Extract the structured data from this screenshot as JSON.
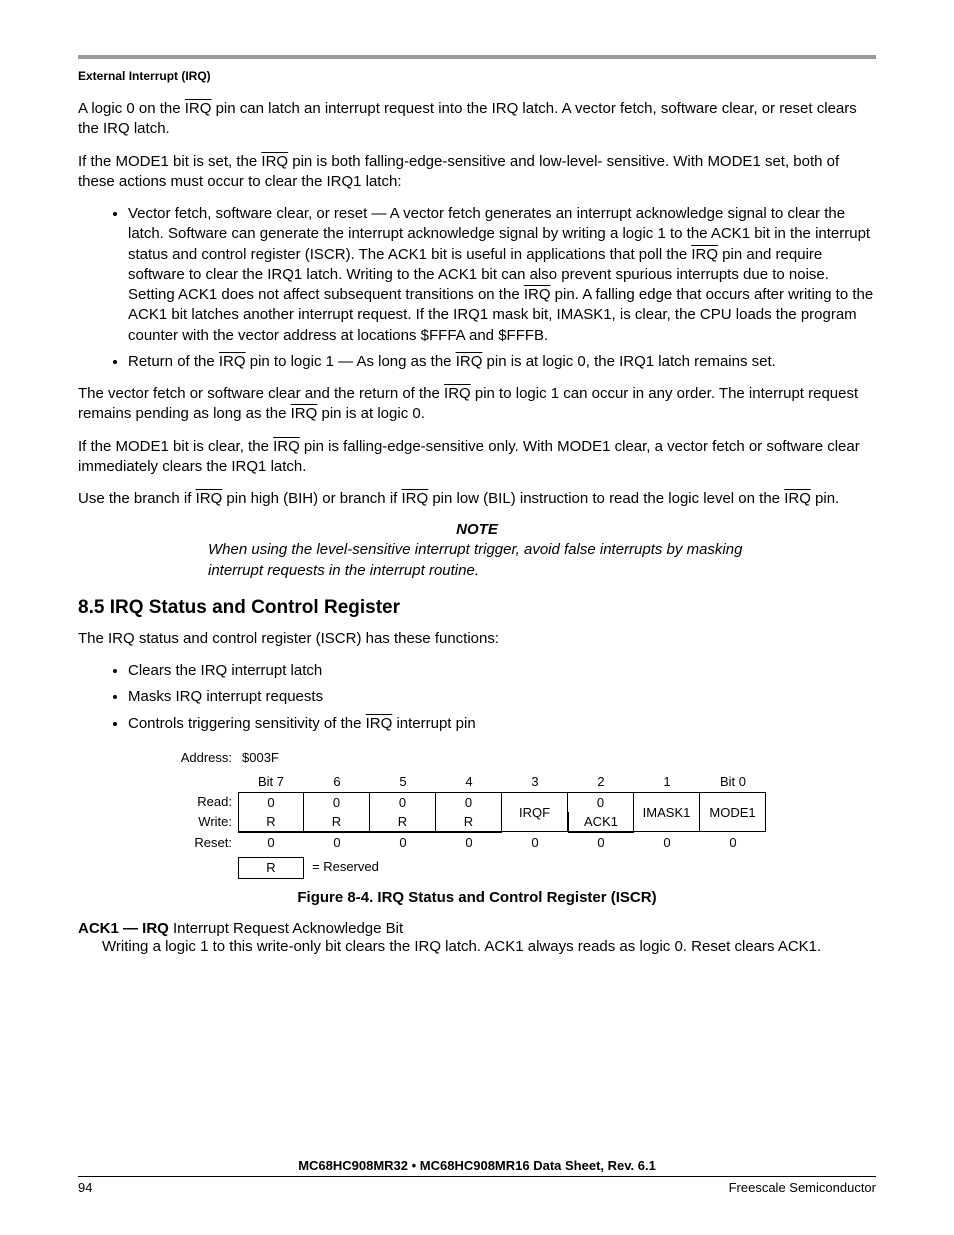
{
  "header": {
    "section": "External Interrupt (IRQ)"
  },
  "p1_a": "A logic 0 on the ",
  "p1_b": " pin can latch an interrupt request into the IRQ latch. A vector fetch, software clear, or reset clears the IRQ latch.",
  "p2_a": "If the MODE1 bit is set, the ",
  "p2_b": " pin is both falling-edge-sensitive and low-level- sensitive. With MODE1 set, both of these actions must occur to clear the IRQ1 latch:",
  "b1_a": "Vector fetch, software clear, or reset — A vector fetch generates an interrupt acknowledge signal to clear the latch. Software can generate the interrupt acknowledge signal by writing a logic 1 to the ACK1 bit in the interrupt status and control register (ISCR). The ACK1 bit is useful in applications that poll the ",
  "b1_b": " pin and require software to clear the IRQ1 latch. Writing to the ACK1 bit can also prevent spurious interrupts due to noise. Setting ACK1 does not affect subsequent transitions on the ",
  "b1_c": " pin. A falling edge that occurs after writing to the ACK1 bit latches another interrupt request. If the IRQ1 mask bit, IMASK1, is clear, the CPU loads the program counter with the vector address at locations $FFFA and $FFFB.",
  "b2_a": "Return of the ",
  "b2_b": " pin to logic 1 — As long as the ",
  "b2_c": " pin is at logic 0, the IRQ1 latch remains set.",
  "p3_a": "The vector fetch or software clear and the return of the ",
  "p3_b": " pin to logic 1 can occur in any order. The interrupt request remains pending as long as the ",
  "p3_c": " pin is at logic 0.",
  "p4_a": "If the MODE1 bit is clear, the ",
  "p4_b": " pin is falling-edge-sensitive only. With MODE1 clear, a vector fetch or software clear immediately clears the IRQ1 latch.",
  "p5_a": "Use the branch if ",
  "p5_b": " pin high (BIH) or branch if ",
  "p5_c": " pin low (BIL) instruction to read the logic level on the ",
  "p5_d": " pin.",
  "irq": "IRQ",
  "note": {
    "title": "NOTE",
    "body": "When using the level-sensitive interrupt trigger, avoid false interrupts by masking interrupt requests in the interrupt routine."
  },
  "section85": {
    "heading": "8.5  IRQ Status and Control Register",
    "intro": "The IRQ status and control register (ISCR) has these functions:",
    "bullets": {
      "b1": "Clears the IRQ interrupt latch",
      "b2": "Masks IRQ interrupt requests",
      "b3_a": "Controls triggering sensitivity of the ",
      "b3_b": " interrupt pin"
    }
  },
  "register": {
    "address_label": "Address:",
    "address": "$003F",
    "bitlabels": [
      "Bit 7",
      "6",
      "5",
      "4",
      "3",
      "2",
      "1",
      "Bit 0"
    ],
    "read_label": "Read:",
    "write_label": "Write:",
    "reset_label": "Reset:",
    "read_row": [
      "0",
      "0",
      "0",
      "0",
      "IRQF",
      "0",
      "IMASK1",
      "MODE1"
    ],
    "write_row": [
      "R",
      "R",
      "R",
      "R",
      "",
      "ACK1",
      "",
      ""
    ],
    "reset_row": [
      "0",
      "0",
      "0",
      "0",
      "0",
      "0",
      "0",
      "0"
    ],
    "reserved_key": "R",
    "reserved_label": "= Reserved",
    "caption": "Figure 8-4. IRQ Status and Control Register (ISCR)"
  },
  "ack1": {
    "title": "ACK1 — IRQ",
    "title_rest": " Interrupt Request Acknowledge Bit",
    "body": "Writing a logic 1 to this write-only bit clears the IRQ latch. ACK1 always reads as logic 0. Reset clears ACK1."
  },
  "footer": {
    "doc": "MC68HC908MR32 • MC68HC908MR16 Data Sheet, Rev. 6.1",
    "page": "94",
    "company": "Freescale Semiconductor"
  }
}
